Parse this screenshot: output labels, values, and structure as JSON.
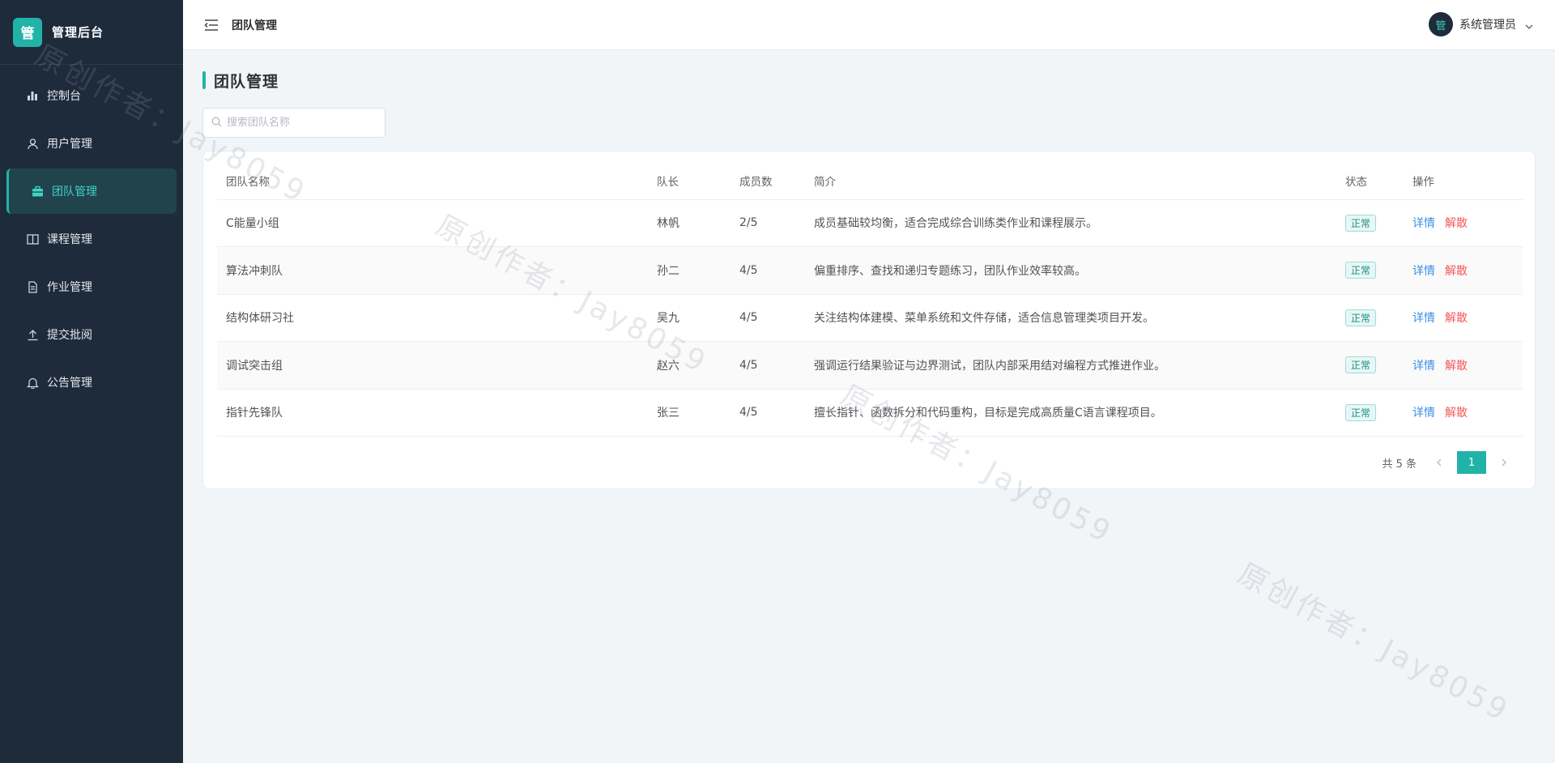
{
  "app": {
    "logo_char": "管",
    "title": "管理后台"
  },
  "sidebar": {
    "items": [
      {
        "label": "控制台",
        "icon": "bar-chart-icon",
        "active": false
      },
      {
        "label": "用户管理",
        "icon": "user-icon",
        "active": false
      },
      {
        "label": "团队管理",
        "icon": "briefcase-icon",
        "active": true
      },
      {
        "label": "课程管理",
        "icon": "book-icon",
        "active": false
      },
      {
        "label": "作业管理",
        "icon": "document-icon",
        "active": false
      },
      {
        "label": "提交批阅",
        "icon": "upload-icon",
        "active": false
      },
      {
        "label": "公告管理",
        "icon": "bell-icon",
        "active": false
      }
    ]
  },
  "header": {
    "title": "团队管理",
    "avatar_char": "管",
    "user_name": "系统管理员"
  },
  "page": {
    "title": "团队管理"
  },
  "search": {
    "placeholder": "搜索团队名称",
    "value": ""
  },
  "table": {
    "columns": [
      "团队名称",
      "队长",
      "成员数",
      "简介",
      "状态",
      "操作"
    ],
    "rows": [
      {
        "name": "C能量小组",
        "leader": "林帆",
        "members": "2/5",
        "desc": "成员基础较均衡，适合完成综合训练类作业和课程展示。",
        "status": "正常"
      },
      {
        "name": "算法冲刺队",
        "leader": "孙二",
        "members": "4/5",
        "desc": "偏重排序、查找和递归专题练习，团队作业效率较高。",
        "status": "正常"
      },
      {
        "name": "结构体研习社",
        "leader": "吴九",
        "members": "4/5",
        "desc": "关注结构体建模、菜单系统和文件存储，适合信息管理类项目开发。",
        "status": "正常"
      },
      {
        "name": "调试突击组",
        "leader": "赵六",
        "members": "4/5",
        "desc": "强调运行结果验证与边界测试，团队内部采用结对编程方式推进作业。",
        "status": "正常"
      },
      {
        "name": "指针先锋队",
        "leader": "张三",
        "members": "4/5",
        "desc": "擅长指针、函数拆分和代码重构，目标是完成高质量C语言课程项目。",
        "status": "正常"
      }
    ],
    "action_detail": "详情",
    "action_disband": "解散"
  },
  "pagination": {
    "total_text": "共 5 条",
    "current_page": "1"
  },
  "watermark": {
    "text": "原创作者：Jay8059"
  },
  "colors": {
    "accent": "#22b3a8",
    "sidebar_bg": "#1e2b3a",
    "link_blue": "#3a8ee6",
    "link_red": "#f05a5a"
  }
}
